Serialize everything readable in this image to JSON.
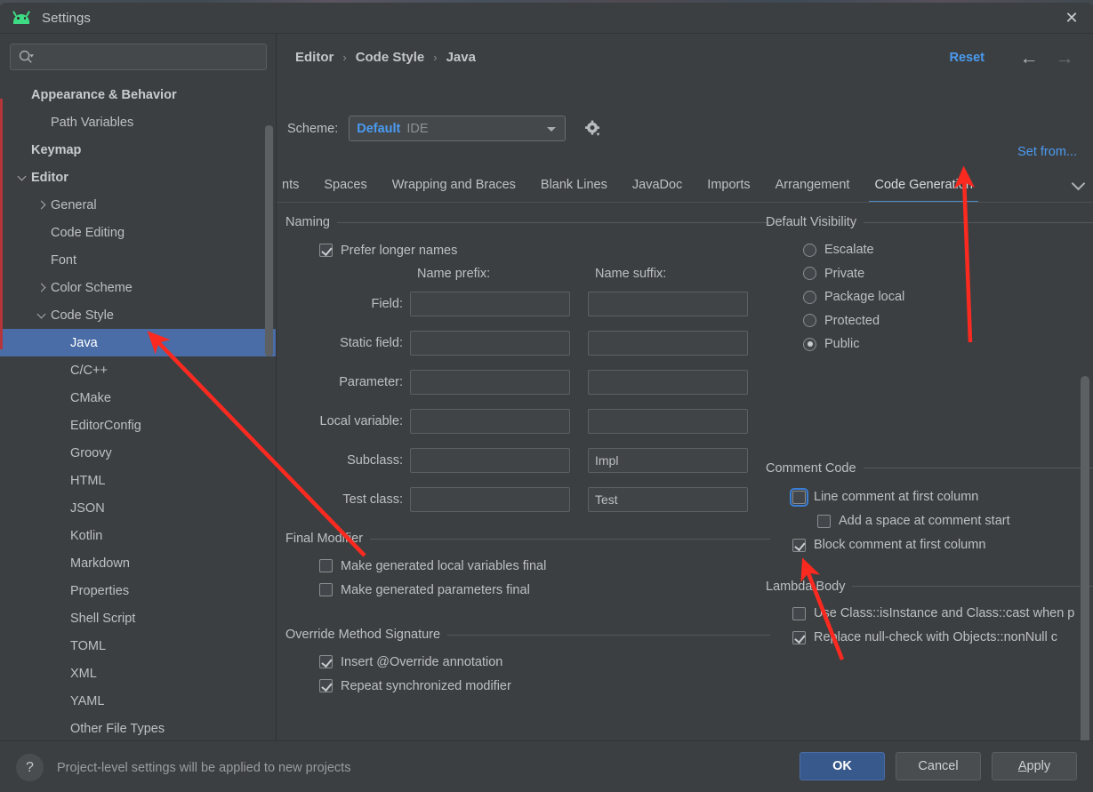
{
  "window": {
    "title": "Settings",
    "app_icon": "android-icon",
    "close_icon": "close-icon"
  },
  "sidebar": {
    "search": {
      "placeholder": "",
      "value": "",
      "icon": "search-icon"
    },
    "items": [
      {
        "label": "Appearance & Behavior",
        "level": 0,
        "bold": true,
        "arrow": "none",
        "selected": false
      },
      {
        "label": "Path Variables",
        "level": 1,
        "bold": false,
        "arrow": "none",
        "selected": false
      },
      {
        "label": "Keymap",
        "level": 0,
        "bold": true,
        "arrow": "none",
        "selected": false
      },
      {
        "label": "Editor",
        "level": 0,
        "bold": true,
        "arrow": "expanded",
        "selected": false
      },
      {
        "label": "General",
        "level": 1,
        "bold": false,
        "arrow": "collapsed",
        "selected": false
      },
      {
        "label": "Code Editing",
        "level": 1,
        "bold": false,
        "arrow": "none",
        "selected": false
      },
      {
        "label": "Font",
        "level": 1,
        "bold": false,
        "arrow": "none",
        "selected": false
      },
      {
        "label": "Color Scheme",
        "level": 1,
        "bold": false,
        "arrow": "collapsed",
        "selected": false
      },
      {
        "label": "Code Style",
        "level": 1,
        "bold": false,
        "arrow": "expanded",
        "selected": false
      },
      {
        "label": "Java",
        "level": 2,
        "bold": false,
        "arrow": "none",
        "selected": true
      },
      {
        "label": "C/C++",
        "level": 2,
        "bold": false,
        "arrow": "none",
        "selected": false
      },
      {
        "label": "CMake",
        "level": 2,
        "bold": false,
        "arrow": "none",
        "selected": false
      },
      {
        "label": "EditorConfig",
        "level": 2,
        "bold": false,
        "arrow": "none",
        "selected": false
      },
      {
        "label": "Groovy",
        "level": 2,
        "bold": false,
        "arrow": "none",
        "selected": false
      },
      {
        "label": "HTML",
        "level": 2,
        "bold": false,
        "arrow": "none",
        "selected": false
      },
      {
        "label": "JSON",
        "level": 2,
        "bold": false,
        "arrow": "none",
        "selected": false
      },
      {
        "label": "Kotlin",
        "level": 2,
        "bold": false,
        "arrow": "none",
        "selected": false
      },
      {
        "label": "Markdown",
        "level": 2,
        "bold": false,
        "arrow": "none",
        "selected": false
      },
      {
        "label": "Properties",
        "level": 2,
        "bold": false,
        "arrow": "none",
        "selected": false
      },
      {
        "label": "Shell Script",
        "level": 2,
        "bold": false,
        "arrow": "none",
        "selected": false
      },
      {
        "label": "TOML",
        "level": 2,
        "bold": false,
        "arrow": "none",
        "selected": false
      },
      {
        "label": "XML",
        "level": 2,
        "bold": false,
        "arrow": "none",
        "selected": false
      },
      {
        "label": "YAML",
        "level": 2,
        "bold": false,
        "arrow": "none",
        "selected": false
      },
      {
        "label": "Other File Types",
        "level": 2,
        "bold": false,
        "arrow": "none",
        "selected": false
      }
    ]
  },
  "header": {
    "breadcrumb": [
      "Editor",
      "Code Style",
      "Java"
    ],
    "breadcrumb_separator": "›",
    "reset_label": "Reset",
    "back_icon": "arrow-left-icon",
    "forward_icon": "arrow-right-icon",
    "scheme_label": "Scheme:",
    "scheme_value": "Default",
    "scheme_scope": "IDE",
    "gear_icon": "gear-icon",
    "set_from_label": "Set from..."
  },
  "tabs": {
    "items": [
      {
        "label": "nts",
        "active": false
      },
      {
        "label": "Spaces",
        "active": false
      },
      {
        "label": "Wrapping and Braces",
        "active": false
      },
      {
        "label": "Blank Lines",
        "active": false
      },
      {
        "label": "JavaDoc",
        "active": false
      },
      {
        "label": "Imports",
        "active": false
      },
      {
        "label": "Arrangement",
        "active": false
      },
      {
        "label": "Code Generation",
        "active": true
      }
    ],
    "overflow_icon": "chevron-down-icon"
  },
  "main": {
    "naming": {
      "title": "Naming",
      "prefer_longer_names": {
        "label": "Prefer longer names",
        "checked": true
      },
      "col_prefix": "Name prefix:",
      "col_suffix": "Name suffix:",
      "rows": [
        {
          "label": "Field:",
          "prefix": "",
          "suffix": ""
        },
        {
          "label": "Static field:",
          "prefix": "",
          "suffix": ""
        },
        {
          "label": "Parameter:",
          "prefix": "",
          "suffix": ""
        },
        {
          "label": "Local variable:",
          "prefix": "",
          "suffix": ""
        },
        {
          "label": "Subclass:",
          "prefix": "",
          "suffix": "Impl"
        },
        {
          "label": "Test class:",
          "prefix": "",
          "suffix": "Test"
        }
      ]
    },
    "default_visibility": {
      "title": "Default Visibility",
      "options": [
        {
          "label": "Escalate",
          "selected": false
        },
        {
          "label": "Private",
          "selected": false
        },
        {
          "label": "Package local",
          "selected": false
        },
        {
          "label": "Protected",
          "selected": false
        },
        {
          "label": "Public",
          "selected": true
        }
      ]
    },
    "final_modifier": {
      "title": "Final Modifier",
      "items": [
        {
          "label": "Make generated local variables final",
          "checked": false
        },
        {
          "label": "Make generated parameters final",
          "checked": false
        }
      ]
    },
    "comment_code": {
      "title": "Comment Code",
      "items": [
        {
          "label": "Line comment at first column",
          "checked": false,
          "focused": true,
          "indent": 0
        },
        {
          "label": "Add a space at comment start",
          "checked": false,
          "focused": false,
          "indent": 1
        },
        {
          "label": "Block comment at first column",
          "checked": true,
          "focused": false,
          "indent": 0
        }
      ]
    },
    "override_method_signature": {
      "title": "Override Method Signature",
      "items": [
        {
          "label": "Insert @Override annotation",
          "checked": true
        },
        {
          "label": "Repeat synchronized modifier",
          "checked": true
        }
      ]
    },
    "lambda_body": {
      "title": "Lambda Body",
      "items": [
        {
          "label": "Use Class::isInstance and Class::cast when p",
          "checked": false
        },
        {
          "label": "Replace null-check with Objects::nonNull c",
          "checked": true
        }
      ]
    }
  },
  "footer": {
    "help_icon": "question-mark-icon",
    "note": "Project-level settings will be applied to new projects",
    "ok_label": "OK",
    "cancel_label": "Cancel",
    "apply_label": "Apply"
  },
  "colors": {
    "window_bg": "#3c3f41",
    "selection": "#4a6da7",
    "accent_link": "#4a9bf2",
    "tab_underline": "#4a88c7",
    "annotation_arrow": "#fa2a20",
    "android_green": "#3ddc84"
  }
}
